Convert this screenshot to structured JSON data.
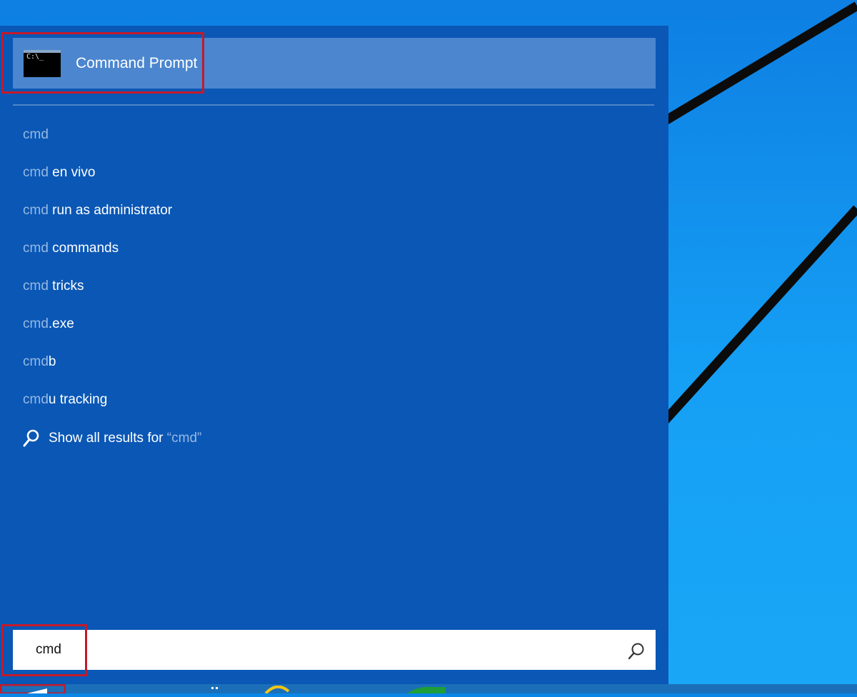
{
  "top_result": {
    "label": "Command Prompt",
    "icon": "command-prompt-icon",
    "icon_text": "C:\\_"
  },
  "suggestions": [
    {
      "query": "cmd",
      "rest": ""
    },
    {
      "query": "cmd",
      "rest": " en vivo"
    },
    {
      "query": "cmd",
      "rest": " run as administrator"
    },
    {
      "query": "cmd",
      "rest": " commands"
    },
    {
      "query": "cmd",
      "rest": " tricks"
    },
    {
      "query": "cmd",
      "rest": ".exe"
    },
    {
      "query": "cmd",
      "rest": "b"
    },
    {
      "query": "cmd",
      "rest": "u tracking"
    }
  ],
  "show_all": {
    "prefix": "Show all results for ",
    "query": "“cmd”"
  },
  "search": {
    "value": "cmd"
  },
  "colors": {
    "panel": "#0a57b5",
    "selected": "#4b86cf",
    "highlight_border": "#c41a2a",
    "query_text": "#96b9e3",
    "desktop": "#1aa7f7"
  }
}
